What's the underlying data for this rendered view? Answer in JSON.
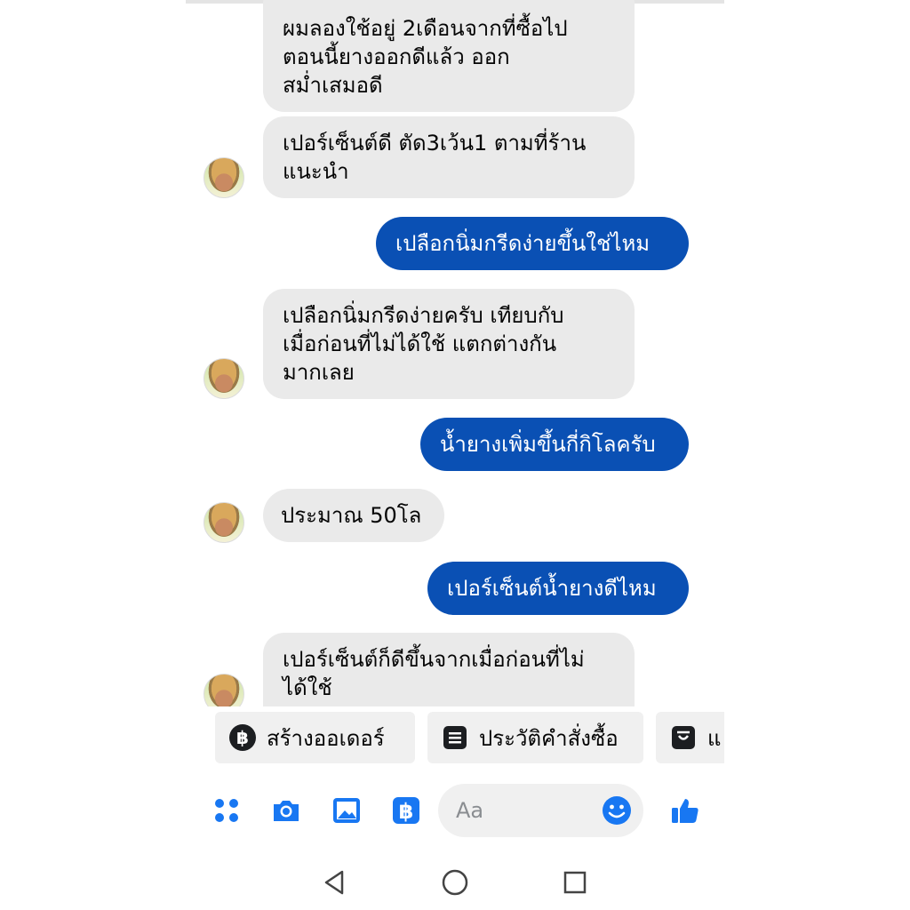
{
  "messages": [
    {
      "dir": "in",
      "lines": [
        "ผมลองใช้อยู่ 2เดือนจากที่ซื้อไป",
        "ตอนนี้ยางออกดีแล้ว ออก",
        "สม่ำเสมอดี"
      ]
    },
    {
      "dir": "in",
      "lines": [
        "เปอร์เซ็นต์ดี ตัด3เว้น1 ตามที่ร้าน",
        "แนะนำ"
      ]
    },
    {
      "dir": "out",
      "lines": [
        "เปลือกนิ่มกรีดง่ายขึ้นใช่ไหม"
      ]
    },
    {
      "dir": "in",
      "lines": [
        "เปลือกนิ่มกรีดง่ายครับ เทียบกับ",
        "เมื่อก่อนที่ไม่ได้ใช้ แตกต่างกัน",
        "มากเลย"
      ]
    },
    {
      "dir": "out",
      "lines": [
        "น้ำยางเพิ่มขึ้นกี่กิโลครับ"
      ]
    },
    {
      "dir": "in",
      "lines": [
        "ประมาณ 50โล"
      ]
    },
    {
      "dir": "out",
      "lines": [
        "เปอร์เซ็นต์น้ำยางดีไหม"
      ]
    },
    {
      "dir": "in",
      "lines": [
        "เปอร์เซ็นต์ก็ดีขึ้นจากเมื่อก่อนที่ไม่",
        "ได้ใช้"
      ]
    }
  ],
  "quick_actions": [
    {
      "label": "สร้างออเดอร์",
      "icon": "baht-icon"
    },
    {
      "label": "ประวัติคำสั่งซื้อ",
      "icon": "order-list-icon"
    },
    {
      "label": "แ",
      "icon": "shopping-bag-icon"
    }
  ],
  "composer": {
    "placeholder": "Aa",
    "icons": [
      "menu-dots-icon",
      "camera-icon",
      "image-icon",
      "baht-icon",
      "emoji-icon",
      "like-icon"
    ]
  },
  "nav": {
    "icons": [
      "back-icon",
      "home-icon",
      "recents-icon"
    ]
  },
  "colors": {
    "accent": "#0a50b4",
    "icon_blue": "#1877f2",
    "incoming_bubble": "#eaeaea"
  }
}
